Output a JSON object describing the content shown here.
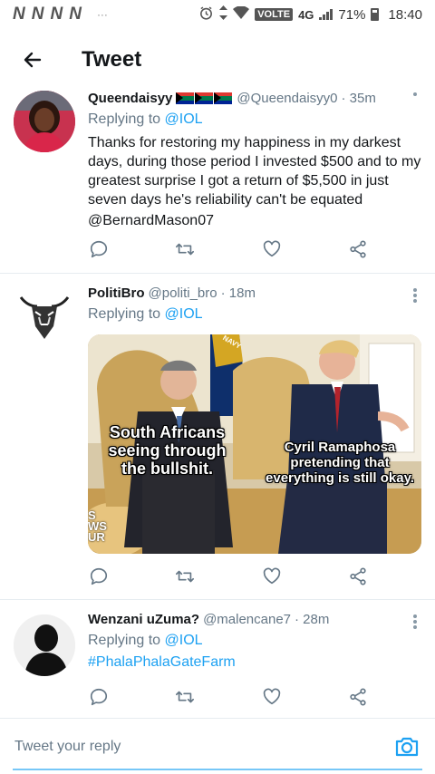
{
  "status_bar": {
    "notification_glyphs": [
      "N",
      "N",
      "N",
      "N"
    ],
    "overflow": "···",
    "volte": "VOLTE",
    "network": "4G",
    "battery": "71%",
    "time": "18:40"
  },
  "header": {
    "title": "Tweet"
  },
  "tweets": [
    {
      "name": "Queendaisyy",
      "flags": "🇿🇦🇿🇦🇿🇦",
      "handle": "@Queendaisyy0",
      "time": "· 35m",
      "replying_prefix": "Replying to ",
      "replying_to": "@IOL",
      "text": "Thanks for restoring my happiness in my darkest days, during those period I invested $500 and to my greatest surprise I got a return of $5,500 in just seven days he's reliability can't be equated",
      "mention": "@BernardMason07"
    },
    {
      "name": "PolitiBro",
      "handle": "@politi_bro",
      "time": "· 18m",
      "replying_prefix": "Replying to ",
      "replying_to": "@IOL",
      "media": {
        "caption_left": "South Africans seeing through the bullshit.",
        "caption_right": "Cyril Ramaphosa pretending that everything is still okay.",
        "navy_flag": "NAVY",
        "watermark": "S\nWS\nUR"
      }
    },
    {
      "name": "Wenzani uZuma?",
      "handle": "@malencane7",
      "time": "· 28m",
      "replying_prefix": "Replying to ",
      "replying_to": "@IOL",
      "hashtag": "#PhalaPhalaGateFarm"
    }
  ],
  "reply": {
    "placeholder": "Tweet your reply"
  },
  "colors": {
    "accent": "#1da1f2",
    "text": "#14171a",
    "muted": "#657786",
    "icon": "#657786"
  }
}
